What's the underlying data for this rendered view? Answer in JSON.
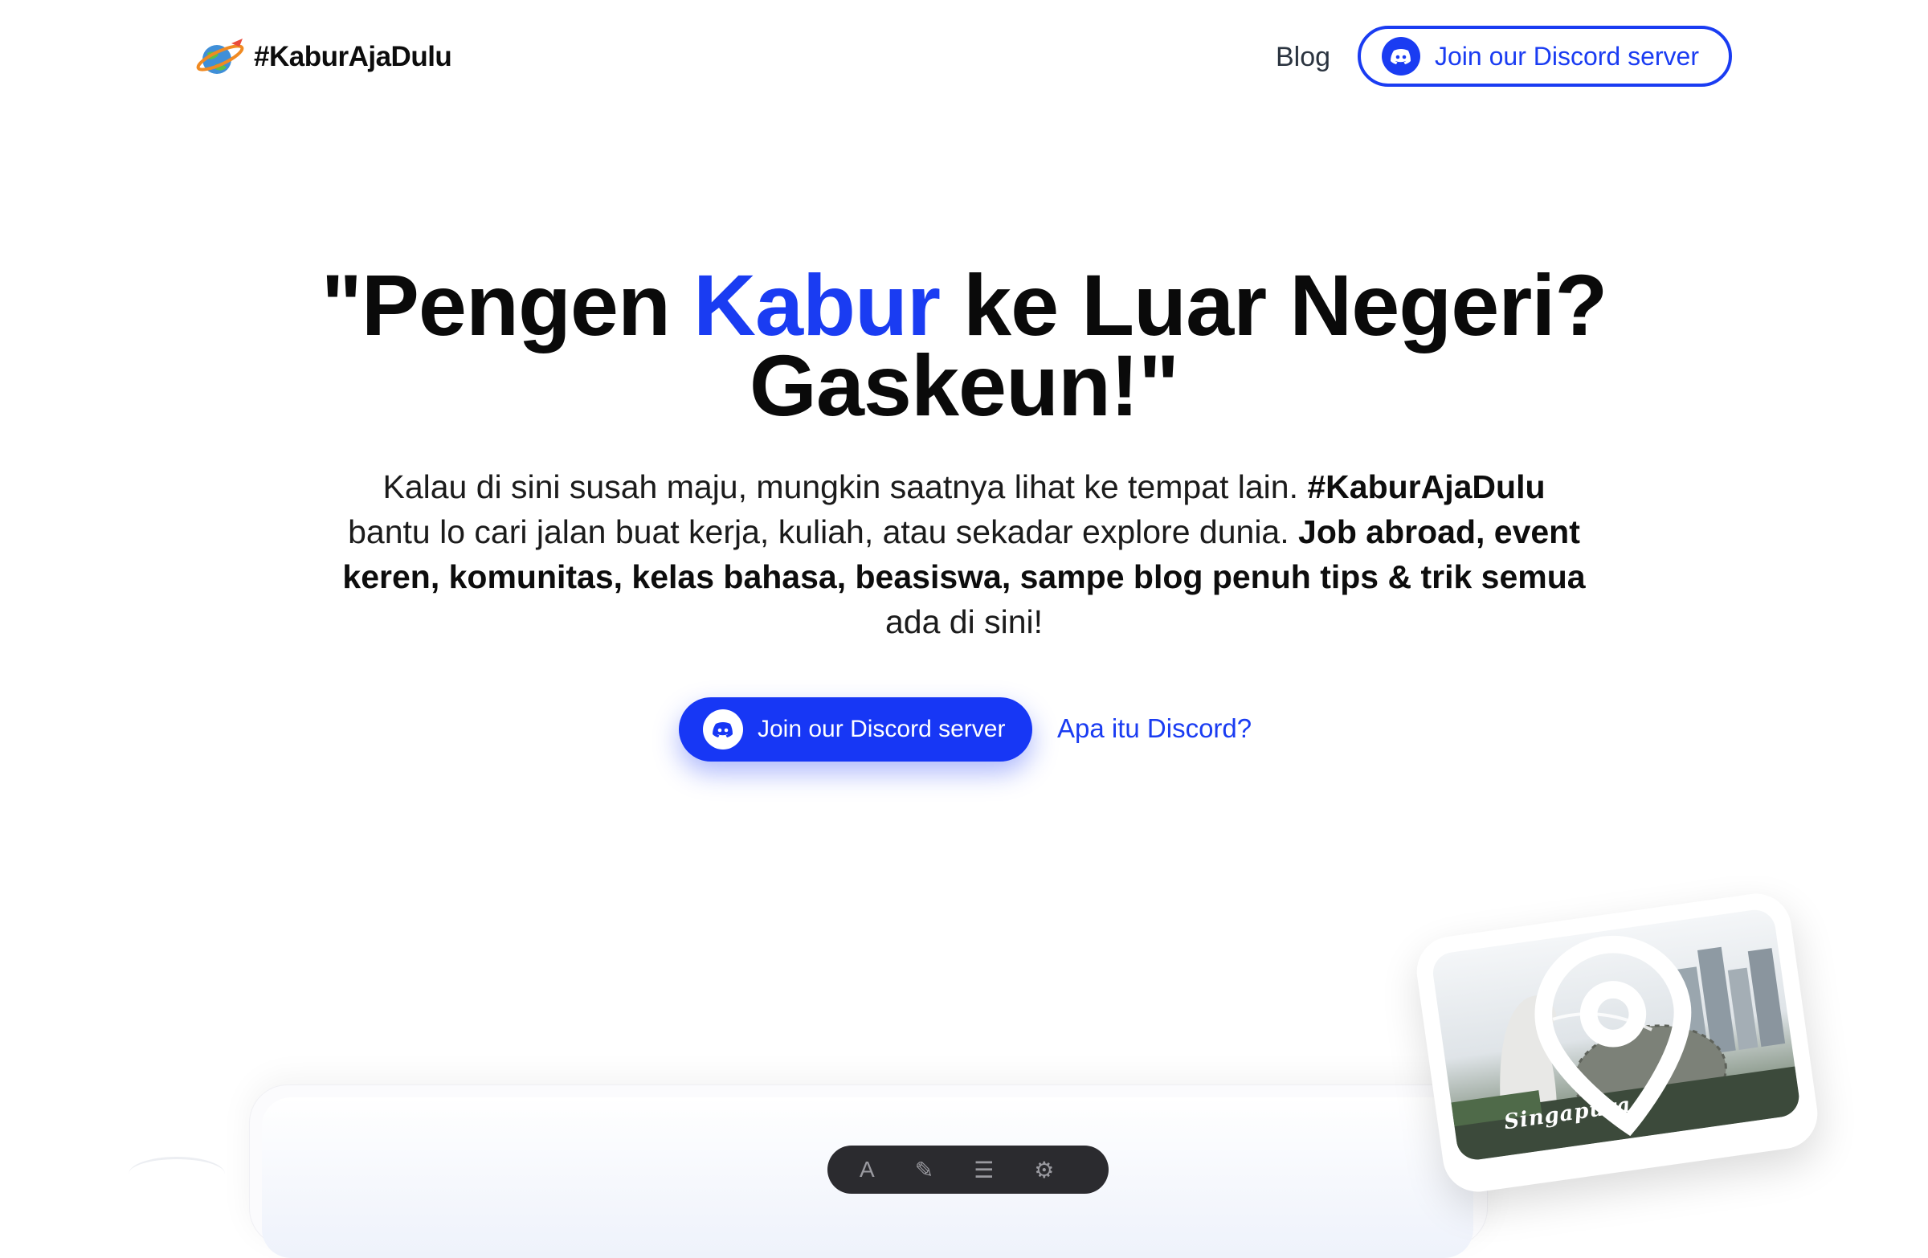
{
  "nav": {
    "brand": "#KaburAjaDulu",
    "blog_label": "Blog",
    "discord_label": "Join our Discord server"
  },
  "hero": {
    "headline_pre": "\"Pengen ",
    "headline_highlight": "Kabur",
    "headline_post": " ke Luar Negeri? Gaskeun!\"",
    "intro_1": "Kalau di sini susah maju, mungkin saatnya lihat ke tempat lain. ",
    "intro_tag": "#KaburAjaDulu",
    "intro_2": " bantu lo cari jalan buat kerja, kuliah, atau sekadar explore dunia. ",
    "intro_bold": "Job abroad, event keren, komunitas, kelas bahasa, beasiswa, sampe blog penuh tips & trik semua",
    "intro_3": " ada di sini!",
    "cta_label": "Join our Discord server",
    "secondary_link": "Apa itu Discord?"
  },
  "postcard": {
    "location": "Singapura"
  },
  "colors": {
    "accent": "#1a3cf2",
    "text": "#0a0a0a",
    "background": "#ffffff"
  }
}
